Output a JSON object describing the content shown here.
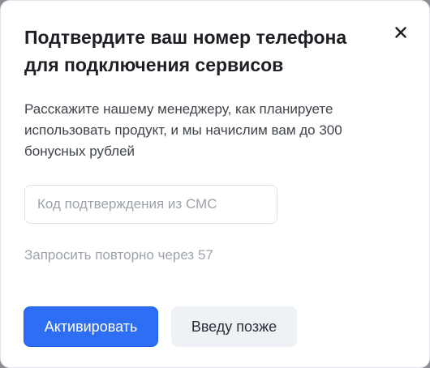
{
  "dialog": {
    "title": "Подтвердите ваш номер телефона для подключения сервисов",
    "close_icon": "close-icon",
    "description": "Расскажите нашему менеджеру, как планируете использовать продукт, и мы начислим вам до 300 бонусных рублей",
    "code_input": {
      "placeholder": "Код подтверждения из СМС",
      "value": ""
    },
    "resend_text": "Запросить повторно через 57",
    "buttons": {
      "activate_label": "Активировать",
      "later_label": "Введу позже"
    }
  },
  "colors": {
    "primary": "#2e6ef5",
    "secondary_bg": "#eef1f6",
    "muted_text": "#9ea3ad"
  }
}
